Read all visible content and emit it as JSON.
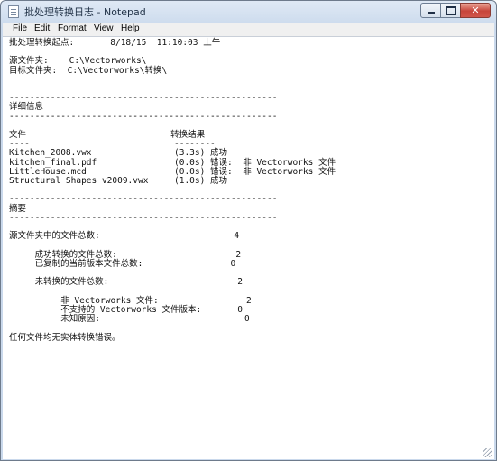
{
  "window": {
    "title": "批处理转换日志 - Notepad",
    "close_glyph": "✕"
  },
  "menu": {
    "items": [
      "File",
      "Edit",
      "Format",
      "View",
      "Help"
    ]
  },
  "document": {
    "text": "批处理转换起点:       8/18/15  11:10:03 上午\n\n源文件夹:    C:\\Vectorworks\\\n目标文件夹:  C:\\Vectorworks\\转换\\\n\n\n----------------------------------------------------\n详细信息\n----------------------------------------------------\n\n文件                            转换结果\n----                            --------\nKitchen_2008.vwx                (3.3s) 成功\nkitchen_final.pdf               (0.0s) 错误:  非 Vectorworks 文件\nLittleHouse.mcd                 (0.0s) 错误:  非 Vectorworks 文件\nStructural Shapes v2009.vwx     (1.0s) 成功\n\n----------------------------------------------------\n摘要\n----------------------------------------------------\n\n源文件夹中的文件总数:                          4\n\n     成功转换的文件总数:                       2\n     已复制的当前版本文件总数:                 0\n\n     未转换的文件总数:                         2\n\n          非 Vectorworks 文件:                 2\n          不支持的 Vectorworks 文件版本:       0\n          未知原因:                            0\n\n任何文件均无实体转换错误。"
  }
}
